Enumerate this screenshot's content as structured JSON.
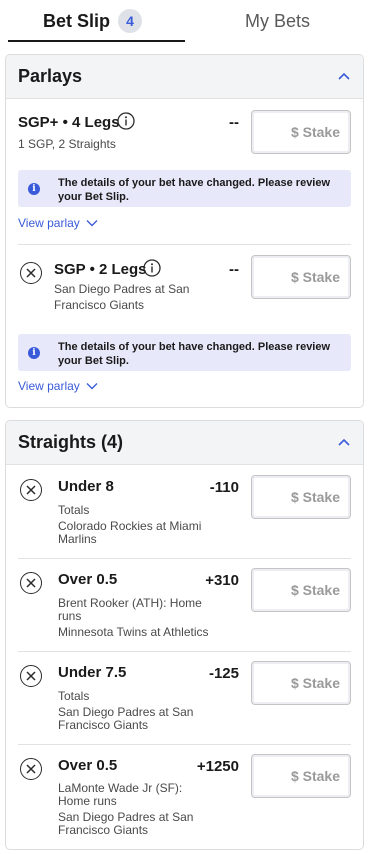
{
  "tabs": {
    "bet_slip": {
      "label": "Bet Slip",
      "badge": "4"
    },
    "my_bets": {
      "label": "My Bets"
    }
  },
  "parlays": {
    "title": "Parlays",
    "items": [
      {
        "title": "SGP+ • 4 Legs",
        "subtitle": "1 SGP, 2 Straights",
        "odds": "--",
        "stake_placeholder": "$ Stake",
        "alert": "The details of your bet have changed. Please review your Bet Slip.",
        "view_link": "View parlay"
      },
      {
        "title": "SGP • 2 Legs",
        "subtitle_line1": "San Diego Padres at San",
        "subtitle_line2": "Francisco Giants",
        "odds": "--",
        "stake_placeholder": "$ Stake",
        "alert": "The details of your bet have changed. Please review your Bet Slip.",
        "view_link": "View parlay"
      }
    ]
  },
  "straights": {
    "title": "Straights (4)",
    "items": [
      {
        "title": "Under 8",
        "odds": "-110",
        "market": "Totals",
        "game_line1": "Colorado Rockies at Miami",
        "game_line2": "Marlins",
        "stake_placeholder": "$ Stake"
      },
      {
        "title": "Over 0.5",
        "odds": "+310",
        "market_line1": "Brent Rooker (ATH): Home",
        "market_line2": "runs",
        "game_line1": "Minnesota Twins at Athletics",
        "stake_placeholder": "$ Stake"
      },
      {
        "title": "Under 7.5",
        "odds": "-125",
        "market": "Totals",
        "game_line1": "San Diego Padres at San",
        "game_line2": "Francisco Giants",
        "stake_placeholder": "$ Stake"
      },
      {
        "title": "Over 0.5",
        "odds": "+1250",
        "market_line1": "LaMonte Wade Jr (SF):",
        "market_line2": "Home runs",
        "game_line1": "San Diego Padres at San",
        "game_line2": "Francisco Giants",
        "stake_placeholder": "$ Stake"
      }
    ]
  },
  "colors": {
    "accent": "#3a5bd9",
    "alert_bg": "#e8e8fb",
    "header_bg": "#f3f4f6"
  }
}
